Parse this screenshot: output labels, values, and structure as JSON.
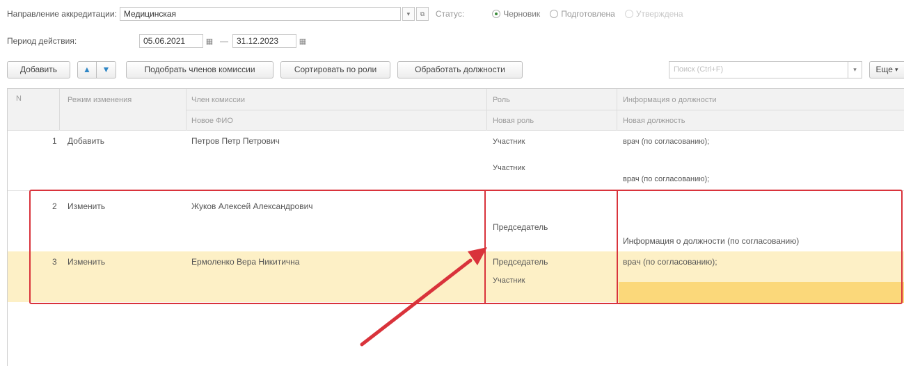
{
  "header": {
    "accreditation_label": "Направление аккредитации:",
    "accreditation_value": "Медицинская",
    "status_label": "Статус:",
    "status_options": [
      "Черновик",
      "Подготовлена",
      "Утверждена"
    ],
    "period_label": "Период действия:",
    "period_from": "05.06.2021",
    "period_separator": "—",
    "period_to": "31.12.2023"
  },
  "toolbar": {
    "add_label": "Добавить",
    "pick_label": "Подобрать членов комиссии",
    "sort_label": "Сортировать по роли",
    "process_label": "Обработать должности",
    "search_placeholder": "Поиск (Ctrl+F)",
    "more_label": "Еще"
  },
  "table": {
    "columns": {
      "n": "N",
      "mode": "Режим изменения",
      "member": "Член комиссии",
      "member_new": "Новое ФИО",
      "role": "Роль",
      "role_new": "Новая роль",
      "position": "Информация о должности",
      "position_new": "Новая должность"
    },
    "rows": [
      {
        "n": "1",
        "mode": "Добавить",
        "member": "Петров Петр Петрович",
        "role": "Участник",
        "role_new": "Участник",
        "position": "врач (по согласованию);",
        "position_new": "врач (по согласованию);"
      },
      {
        "n": "2",
        "mode": "Изменить",
        "member": "Жуков Алексей Александрович",
        "role": "",
        "role_new": "Председатель",
        "position": "",
        "position_new": "Информация о должности (по согласованию)"
      },
      {
        "n": "3",
        "mode": "Изменить",
        "member": "Ермоленко Вера Никитична",
        "role": "Председатель",
        "role_new": "Участник",
        "position": "врач (по согласованию);",
        "position_new": ""
      }
    ]
  },
  "colors": {
    "highlight_row": "#fdf0c6",
    "highlight_band": "#fbd87a",
    "annotation_red": "#d9333b"
  }
}
